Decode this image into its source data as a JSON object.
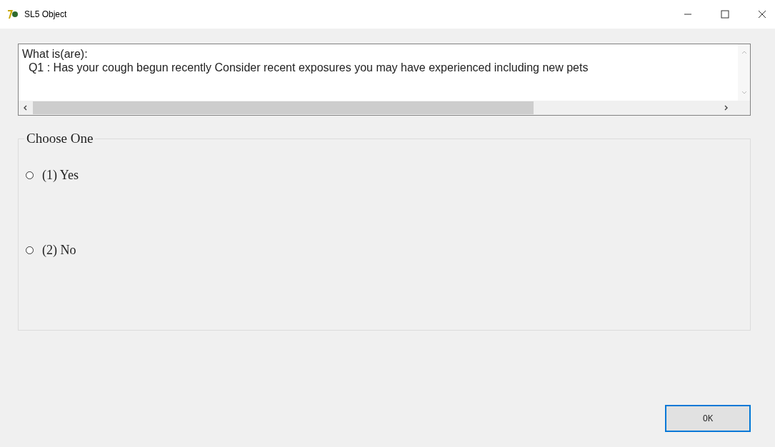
{
  "window": {
    "title": "SL5 Object"
  },
  "question": {
    "lines": [
      "What is(are):",
      "  Q1 : Has your cough begun recently Consider recent exposures you may have experienced including new pets"
    ]
  },
  "choice_group": {
    "title": "Choose One",
    "options": [
      {
        "label": "(1) Yes",
        "selected": false
      },
      {
        "label": "(2) No",
        "selected": false
      }
    ]
  },
  "buttons": [
    "OK"
  ]
}
